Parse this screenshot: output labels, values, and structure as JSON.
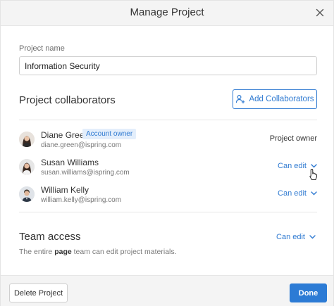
{
  "dialog": {
    "title": "Manage Project",
    "close_icon": "close-icon"
  },
  "project_name": {
    "label": "Project name",
    "value": "Information Security"
  },
  "collaborators": {
    "title": "Project collaborators",
    "add_button_label": "Add Collaborators",
    "add_button_icon": "add-user-icon",
    "members": [
      {
        "name": "Diane Green",
        "badge": "Account owner",
        "email": "diane.green@ispring.com",
        "role": "Project owner"
      },
      {
        "name": "Susan Williams",
        "email": "susan.williams@ispring.com",
        "role": "Can edit"
      },
      {
        "name": "William Kelly",
        "email": "william.kelly@ispring.com",
        "role": "Can edit"
      }
    ]
  },
  "team_access": {
    "title": "Team access",
    "role": "Can edit",
    "note_prefix": "The entire ",
    "note_bold": "page",
    "note_suffix": " team can edit project materials."
  },
  "footer": {
    "delete_label": "Delete Project",
    "done_label": "Done"
  },
  "colors": {
    "accent": "#2c7bd5",
    "badge_bg": "#e3eefb",
    "header_bg": "#f4f4f4"
  }
}
